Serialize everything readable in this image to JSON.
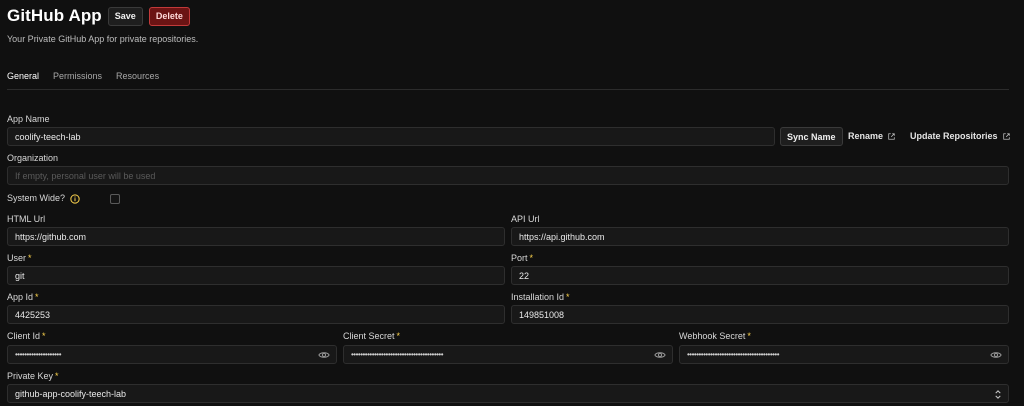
{
  "header": {
    "title": "GitHub App",
    "save_label": "Save",
    "delete_label": "Delete",
    "subtitle": "Your Private GitHub App for private repositories."
  },
  "tabs": [
    {
      "label": "General",
      "active": true
    },
    {
      "label": "Permissions",
      "active": false
    },
    {
      "label": "Resources",
      "active": false
    }
  ],
  "form": {
    "app_name": {
      "label": "App Name",
      "value": "coolify-teech-lab"
    },
    "sync_name_label": "Sync Name",
    "rename_label": "Rename",
    "update_repositories_label": "Update Repositories",
    "organization": {
      "label": "Organization",
      "placeholder": "If empty, personal user will be used"
    },
    "system_wide": {
      "label": "System Wide?",
      "checked": false
    },
    "html_url": {
      "label": "HTML Url",
      "value": "https://github.com"
    },
    "api_url": {
      "label": "API Url",
      "value": "https://api.github.com"
    },
    "user": {
      "label": "User",
      "required": "*",
      "value": "git"
    },
    "port": {
      "label": "Port",
      "required": "*",
      "value": "22"
    },
    "app_id": {
      "label": "App Id",
      "required": "*",
      "value": "4425253"
    },
    "installation_id": {
      "label": "Installation Id",
      "required": "*",
      "value": "149851008"
    },
    "client_id": {
      "label": "Client Id",
      "required": "*",
      "value": "••••••••••••••••••••"
    },
    "client_secret": {
      "label": "Client Secret",
      "required": "*",
      "value": "••••••••••••••••••••••••••••••••••••••••"
    },
    "webhook_secret": {
      "label": "Webhook Secret",
      "required": "*",
      "value": "••••••••••••••••••••••••••••••••••••••••"
    },
    "private_key": {
      "label": "Private Key",
      "required": "*",
      "value": "github-app-coolify-teech-lab"
    }
  },
  "icons": {
    "info": "info-circle-icon",
    "eye": "eye-icon",
    "external": "external-link-icon",
    "select": "chevron-up-down-icon"
  },
  "colors": {
    "background": "#101010",
    "delete_bg": "#6b1414",
    "delete_border": "#c23a3a",
    "required": "#fcd34d"
  }
}
